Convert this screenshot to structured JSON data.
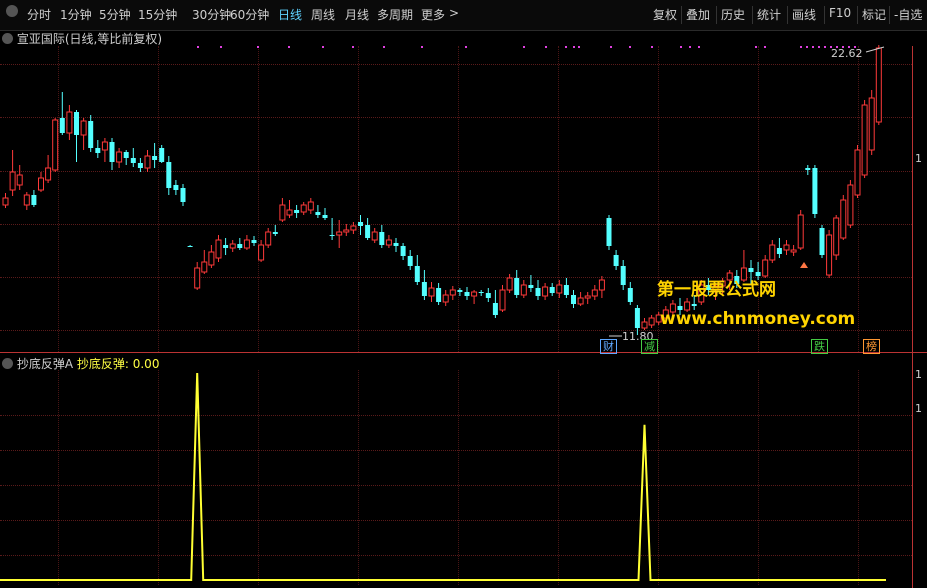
{
  "toolbar": {
    "tabs": [
      {
        "label": "分时",
        "active": false
      },
      {
        "label": "1分钟",
        "active": false
      },
      {
        "label": "5分钟",
        "active": false
      },
      {
        "label": "15分钟",
        "active": false
      },
      {
        "label": "30分钟",
        "active": false
      },
      {
        "label": "60分钟",
        "active": false
      },
      {
        "label": "日线",
        "active": true
      },
      {
        "label": "周线",
        "active": false
      },
      {
        "label": "月线",
        "active": false
      },
      {
        "label": "多周期",
        "active": false
      },
      {
        "label": "更多",
        "active": false
      }
    ],
    "more_arrow": ">",
    "actions": [
      "复权",
      "叠加",
      "历史",
      "统计",
      "画线",
      "F10",
      "标记",
      "-自选"
    ]
  },
  "chart_header": {
    "stock_name": "宣亚国际",
    "mode": "(日线,等比前复权)"
  },
  "price_labels": {
    "high": "22.62",
    "low": "11.80",
    "right_tick": "1"
  },
  "events": [
    {
      "label": "财",
      "color": "#5fa8ff"
    },
    {
      "label": "减",
      "color": "#44cc44"
    },
    {
      "label": "跌",
      "color": "#44cc44"
    },
    {
      "label": "榜",
      "color": "#ff9933"
    }
  ],
  "indicator": {
    "name": "抄底反弹A",
    "line_label": "抄底反弹: 0.00",
    "right_ticks": [
      "1",
      "1"
    ]
  },
  "watermark": {
    "line1": "第一股票公式网",
    "line2": "www.chnmoney.com"
  },
  "colors": {
    "up": "#ff3a3a",
    "down": "#54ffff",
    "indicator": "#ffff33",
    "accent": "#5fd3ff"
  },
  "chart_data": {
    "type": "candlestick",
    "candles": [
      {
        "o": 198,
        "h": 193,
        "l": 208,
        "c": 205,
        "dir": "up"
      },
      {
        "o": 190,
        "h": 150,
        "l": 196,
        "c": 172,
        "dir": "up"
      },
      {
        "o": 185,
        "h": 165,
        "l": 190,
        "c": 175,
        "dir": "up"
      },
      {
        "o": 205,
        "h": 192,
        "l": 210,
        "c": 195,
        "dir": "up"
      },
      {
        "o": 195,
        "h": 190,
        "l": 207,
        "c": 205,
        "dir": "down"
      },
      {
        "o": 190,
        "h": 172,
        "l": 192,
        "c": 178,
        "dir": "up"
      },
      {
        "o": 180,
        "h": 155,
        "l": 183,
        "c": 168,
        "dir": "up"
      },
      {
        "o": 170,
        "h": 118,
        "l": 172,
        "c": 120,
        "dir": "up"
      },
      {
        "o": 118,
        "h": 92,
        "l": 135,
        "c": 133,
        "dir": "down"
      },
      {
        "o": 133,
        "h": 105,
        "l": 140,
        "c": 112,
        "dir": "up"
      },
      {
        "o": 112,
        "h": 110,
        "l": 162,
        "c": 135,
        "dir": "down"
      },
      {
        "o": 135,
        "h": 118,
        "l": 150,
        "c": 121,
        "dir": "up"
      },
      {
        "o": 121,
        "h": 115,
        "l": 152,
        "c": 148,
        "dir": "down"
      },
      {
        "o": 148,
        "h": 140,
        "l": 158,
        "c": 153,
        "dir": "down"
      },
      {
        "o": 150,
        "h": 138,
        "l": 162,
        "c": 142,
        "dir": "up"
      },
      {
        "o": 142,
        "h": 138,
        "l": 170,
        "c": 162,
        "dir": "down"
      },
      {
        "o": 162,
        "h": 148,
        "l": 168,
        "c": 152,
        "dir": "up"
      },
      {
        "o": 152,
        "h": 150,
        "l": 165,
        "c": 158,
        "dir": "down"
      },
      {
        "o": 158,
        "h": 148,
        "l": 167,
        "c": 163,
        "dir": "down"
      },
      {
        "o": 163,
        "h": 158,
        "l": 172,
        "c": 168,
        "dir": "down"
      },
      {
        "o": 168,
        "h": 150,
        "l": 172,
        "c": 156,
        "dir": "up"
      },
      {
        "o": 156,
        "h": 143,
        "l": 168,
        "c": 160,
        "dir": "down"
      },
      {
        "o": 148,
        "h": 145,
        "l": 163,
        "c": 162,
        "dir": "down"
      },
      {
        "o": 162,
        "h": 156,
        "l": 195,
        "c": 188,
        "dir": "down"
      },
      {
        "o": 185,
        "h": 180,
        "l": 195,
        "c": 190,
        "dir": "down"
      },
      {
        "o": 188,
        "h": 184,
        "l": 206,
        "c": 202,
        "dir": "down"
      },
      {
        "o": 246,
        "h": 245,
        "l": 247,
        "c": 246,
        "dir": "down"
      },
      {
        "o": 288,
        "h": 262,
        "l": 290,
        "c": 268,
        "dir": "up"
      },
      {
        "o": 272,
        "h": 250,
        "l": 274,
        "c": 262,
        "dir": "up"
      },
      {
        "o": 265,
        "h": 245,
        "l": 268,
        "c": 252,
        "dir": "up"
      },
      {
        "o": 258,
        "h": 235,
        "l": 262,
        "c": 240,
        "dir": "up"
      },
      {
        "o": 245,
        "h": 238,
        "l": 255,
        "c": 248,
        "dir": "down"
      },
      {
        "o": 248,
        "h": 240,
        "l": 252,
        "c": 244,
        "dir": "up"
      },
      {
        "o": 244,
        "h": 238,
        "l": 250,
        "c": 248,
        "dir": "down"
      },
      {
        "o": 248,
        "h": 235,
        "l": 250,
        "c": 240,
        "dir": "up"
      },
      {
        "o": 240,
        "h": 236,
        "l": 246,
        "c": 243,
        "dir": "down"
      },
      {
        "o": 260,
        "h": 240,
        "l": 262,
        "c": 245,
        "dir": "up"
      },
      {
        "o": 245,
        "h": 228,
        "l": 248,
        "c": 232,
        "dir": "up"
      },
      {
        "o": 232,
        "h": 225,
        "l": 236,
        "c": 234,
        "dir": "down"
      },
      {
        "o": 220,
        "h": 198,
        "l": 222,
        "c": 205,
        "dir": "up"
      },
      {
        "o": 215,
        "h": 200,
        "l": 218,
        "c": 210,
        "dir": "up"
      },
      {
        "o": 210,
        "h": 205,
        "l": 218,
        "c": 213,
        "dir": "down"
      },
      {
        "o": 212,
        "h": 202,
        "l": 215,
        "c": 205,
        "dir": "up"
      },
      {
        "o": 210,
        "h": 198,
        "l": 214,
        "c": 202,
        "dir": "up"
      },
      {
        "o": 212,
        "h": 205,
        "l": 218,
        "c": 215,
        "dir": "down"
      },
      {
        "o": 215,
        "h": 208,
        "l": 220,
        "c": 218,
        "dir": "down"
      },
      {
        "o": 235,
        "h": 218,
        "l": 240,
        "c": 235,
        "dir": "down"
      },
      {
        "o": 235,
        "h": 220,
        "l": 248,
        "c": 232,
        "dir": "up"
      },
      {
        "o": 232,
        "h": 224,
        "l": 236,
        "c": 230,
        "dir": "up"
      },
      {
        "o": 230,
        "h": 222,
        "l": 234,
        "c": 226,
        "dir": "up"
      },
      {
        "o": 222,
        "h": 215,
        "l": 235,
        "c": 226,
        "dir": "down"
      },
      {
        "o": 225,
        "h": 218,
        "l": 240,
        "c": 238,
        "dir": "down"
      },
      {
        "o": 240,
        "h": 228,
        "l": 243,
        "c": 232,
        "dir": "up"
      },
      {
        "o": 232,
        "h": 225,
        "l": 248,
        "c": 245,
        "dir": "down"
      },
      {
        "o": 245,
        "h": 235,
        "l": 248,
        "c": 240,
        "dir": "up"
      },
      {
        "o": 243,
        "h": 238,
        "l": 252,
        "c": 246,
        "dir": "down"
      },
      {
        "o": 246,
        "h": 243,
        "l": 260,
        "c": 256,
        "dir": "down"
      },
      {
        "o": 256,
        "h": 250,
        "l": 270,
        "c": 266,
        "dir": "down"
      },
      {
        "o": 266,
        "h": 255,
        "l": 285,
        "c": 282,
        "dir": "down"
      },
      {
        "o": 282,
        "h": 270,
        "l": 300,
        "c": 296,
        "dir": "down"
      },
      {
        "o": 296,
        "h": 282,
        "l": 302,
        "c": 288,
        "dir": "up"
      },
      {
        "o": 288,
        "h": 283,
        "l": 305,
        "c": 302,
        "dir": "down"
      },
      {
        "o": 302,
        "h": 290,
        "l": 306,
        "c": 295,
        "dir": "up"
      },
      {
        "o": 295,
        "h": 286,
        "l": 300,
        "c": 290,
        "dir": "up"
      },
      {
        "o": 290,
        "h": 288,
        "l": 296,
        "c": 292,
        "dir": "down"
      },
      {
        "o": 292,
        "h": 287,
        "l": 300,
        "c": 296,
        "dir": "down"
      },
      {
        "o": 296,
        "h": 290,
        "l": 304,
        "c": 292,
        "dir": "up"
      },
      {
        "o": 292,
        "h": 290,
        "l": 296,
        "c": 293,
        "dir": "down"
      },
      {
        "o": 293,
        "h": 288,
        "l": 302,
        "c": 298,
        "dir": "down"
      },
      {
        "o": 303,
        "h": 290,
        "l": 318,
        "c": 315,
        "dir": "down"
      },
      {
        "o": 310,
        "h": 285,
        "l": 312,
        "c": 290,
        "dir": "up"
      },
      {
        "o": 290,
        "h": 274,
        "l": 293,
        "c": 278,
        "dir": "up"
      },
      {
        "o": 278,
        "h": 270,
        "l": 298,
        "c": 295,
        "dir": "down"
      },
      {
        "o": 295,
        "h": 280,
        "l": 298,
        "c": 285,
        "dir": "up"
      },
      {
        "o": 285,
        "h": 275,
        "l": 292,
        "c": 288,
        "dir": "down"
      },
      {
        "o": 288,
        "h": 280,
        "l": 300,
        "c": 296,
        "dir": "down"
      },
      {
        "o": 296,
        "h": 283,
        "l": 300,
        "c": 287,
        "dir": "up"
      },
      {
        "o": 287,
        "h": 283,
        "l": 296,
        "c": 293,
        "dir": "down"
      },
      {
        "o": 293,
        "h": 280,
        "l": 298,
        "c": 285,
        "dir": "up"
      },
      {
        "o": 285,
        "h": 278,
        "l": 298,
        "c": 295,
        "dir": "down"
      },
      {
        "o": 295,
        "h": 290,
        "l": 308,
        "c": 304,
        "dir": "down"
      },
      {
        "o": 304,
        "h": 292,
        "l": 306,
        "c": 298,
        "dir": "up"
      },
      {
        "o": 298,
        "h": 292,
        "l": 304,
        "c": 296,
        "dir": "up"
      },
      {
        "o": 296,
        "h": 285,
        "l": 300,
        "c": 290,
        "dir": "up"
      },
      {
        "o": 290,
        "h": 276,
        "l": 298,
        "c": 280,
        "dir": "up"
      },
      {
        "o": 218,
        "h": 215,
        "l": 250,
        "c": 246,
        "dir": "down"
      },
      {
        "o": 255,
        "h": 250,
        "l": 270,
        "c": 266,
        "dir": "down"
      },
      {
        "o": 266,
        "h": 260,
        "l": 290,
        "c": 285,
        "dir": "down"
      },
      {
        "o": 288,
        "h": 282,
        "l": 305,
        "c": 302,
        "dir": "down"
      },
      {
        "o": 308,
        "h": 305,
        "l": 335,
        "c": 328,
        "dir": "down"
      },
      {
        "o": 328,
        "h": 318,
        "l": 330,
        "c": 322,
        "dir": "up"
      },
      {
        "o": 325,
        "h": 315,
        "l": 328,
        "c": 318,
        "dir": "up"
      },
      {
        "o": 322,
        "h": 312,
        "l": 325,
        "c": 315,
        "dir": "up"
      },
      {
        "o": 318,
        "h": 306,
        "l": 322,
        "c": 310,
        "dir": "up"
      },
      {
        "o": 312,
        "h": 300,
        "l": 316,
        "c": 304,
        "dir": "up"
      },
      {
        "o": 306,
        "h": 298,
        "l": 315,
        "c": 310,
        "dir": "down"
      },
      {
        "o": 310,
        "h": 298,
        "l": 312,
        "c": 302,
        "dir": "up"
      },
      {
        "o": 304,
        "h": 295,
        "l": 310,
        "c": 306,
        "dir": "down"
      },
      {
        "o": 302,
        "h": 280,
        "l": 305,
        "c": 285,
        "dir": "up"
      },
      {
        "o": 285,
        "h": 278,
        "l": 295,
        "c": 290,
        "dir": "down"
      },
      {
        "o": 290,
        "h": 283,
        "l": 300,
        "c": 286,
        "dir": "up"
      },
      {
        "o": 286,
        "h": 278,
        "l": 295,
        "c": 281,
        "dir": "up"
      },
      {
        "o": 280,
        "h": 270,
        "l": 290,
        "c": 273,
        "dir": "up"
      },
      {
        "o": 276,
        "h": 270,
        "l": 288,
        "c": 284,
        "dir": "down"
      },
      {
        "o": 280,
        "h": 250,
        "l": 282,
        "c": 268,
        "dir": "up"
      },
      {
        "o": 268,
        "h": 260,
        "l": 285,
        "c": 272,
        "dir": "down"
      },
      {
        "o": 272,
        "h": 262,
        "l": 280,
        "c": 276,
        "dir": "down"
      },
      {
        "o": 276,
        "h": 255,
        "l": 278,
        "c": 260,
        "dir": "up"
      },
      {
        "o": 260,
        "h": 240,
        "l": 263,
        "c": 245,
        "dir": "up"
      },
      {
        "o": 248,
        "h": 238,
        "l": 258,
        "c": 254,
        "dir": "down"
      },
      {
        "o": 250,
        "h": 240,
        "l": 255,
        "c": 245,
        "dir": "up"
      },
      {
        "o": 250,
        "h": 245,
        "l": 256,
        "c": 252,
        "dir": "up"
      },
      {
        "o": 248,
        "h": 210,
        "l": 250,
        "c": 215,
        "dir": "up"
      },
      {
        "o": 170,
        "h": 165,
        "l": 175,
        "c": 168,
        "dir": "down"
      },
      {
        "o": 168,
        "h": 165,
        "l": 218,
        "c": 214,
        "dir": "down"
      },
      {
        "o": 228,
        "h": 225,
        "l": 258,
        "c": 255,
        "dir": "down"
      },
      {
        "o": 275,
        "h": 230,
        "l": 278,
        "c": 235,
        "dir": "up"
      },
      {
        "o": 255,
        "h": 215,
        "l": 260,
        "c": 218,
        "dir": "up"
      },
      {
        "o": 238,
        "h": 195,
        "l": 240,
        "c": 200,
        "dir": "up"
      },
      {
        "o": 225,
        "h": 180,
        "l": 228,
        "c": 185,
        "dir": "up"
      },
      {
        "o": 195,
        "h": 145,
        "l": 198,
        "c": 150,
        "dir": "up"
      },
      {
        "o": 175,
        "h": 100,
        "l": 178,
        "c": 105,
        "dir": "up"
      },
      {
        "o": 150,
        "h": 90,
        "l": 155,
        "c": 98,
        "dir": "up"
      },
      {
        "o": 122,
        "h": 45,
        "l": 125,
        "c": 48,
        "dir": "up"
      }
    ],
    "indicator_series": {
      "name": "抄底反弹",
      "baseline": 0,
      "peaks": [
        {
          "index": 27,
          "value": 1
        },
        {
          "index": 90,
          "value": 0.75
        }
      ]
    }
  }
}
